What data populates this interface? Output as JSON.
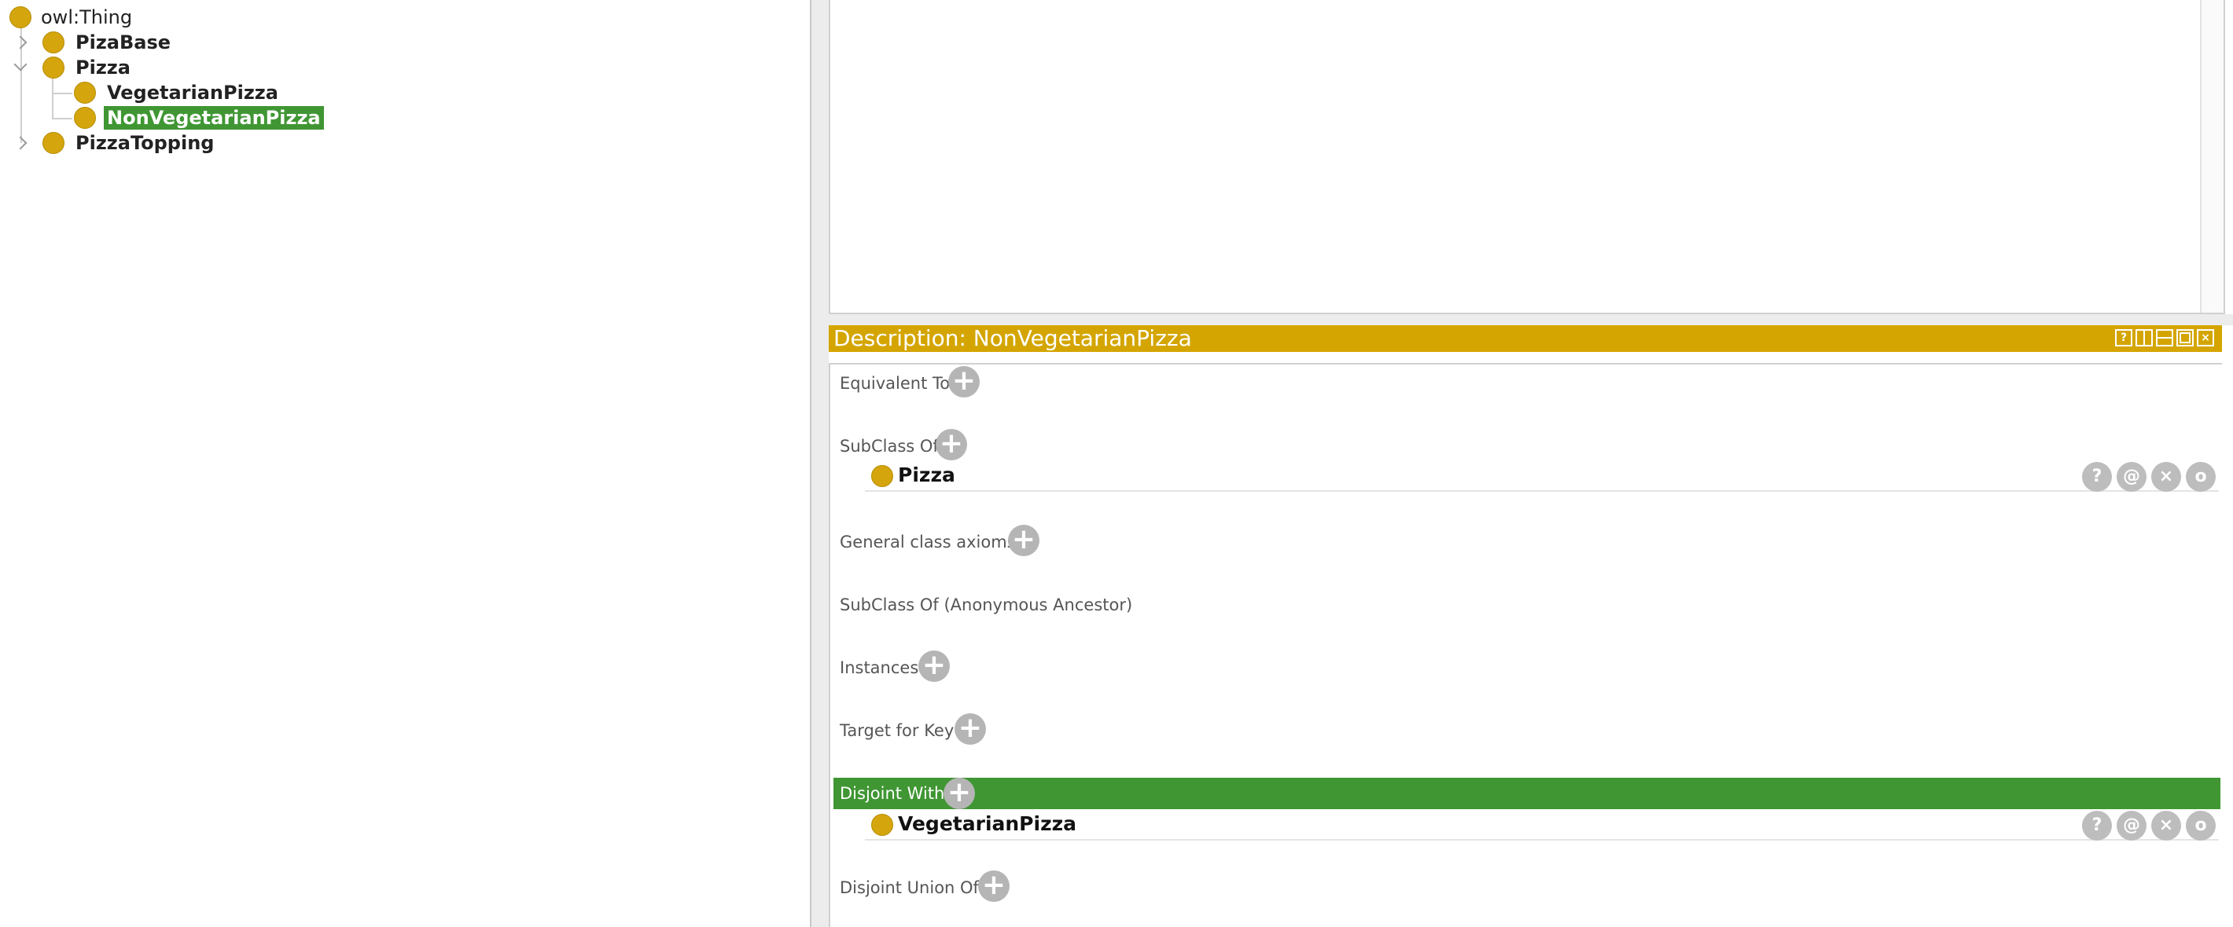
{
  "class_tree": {
    "root": "owl:Thing",
    "items": [
      {
        "label": "PizaBase"
      },
      {
        "label": "Pizza"
      },
      {
        "label": "VegetarianPizza"
      },
      {
        "label": "NonVegetarianPizza",
        "selected": true
      },
      {
        "label": "PizzaTopping"
      }
    ]
  },
  "description": {
    "title": "Description: NonVegetarianPizza",
    "window_buttons": [
      "?",
      "",
      "",
      "",
      "×"
    ],
    "sections": {
      "equivalent_to": "Equivalent To",
      "subclass_of": "SubClass Of",
      "subclass_items": [
        "Pizza"
      ],
      "general_class_axioms": "General class axioms",
      "subclass_anon": "SubClass Of (Anonymous Ancestor)",
      "instances": "Instances",
      "target_for_key": "Target for Key",
      "disjoint_with": "Disjoint With",
      "disjoint_items": [
        "VegetarianPizza"
      ],
      "disjoint_union_of": "Disjoint Union Of"
    },
    "plus": "+",
    "row_buttons": [
      "?",
      "@",
      "×",
      "o"
    ]
  },
  "colors": {
    "class_icon": "#d4a50d",
    "header_bar": "#d4a500",
    "selection": "#3f9633"
  }
}
